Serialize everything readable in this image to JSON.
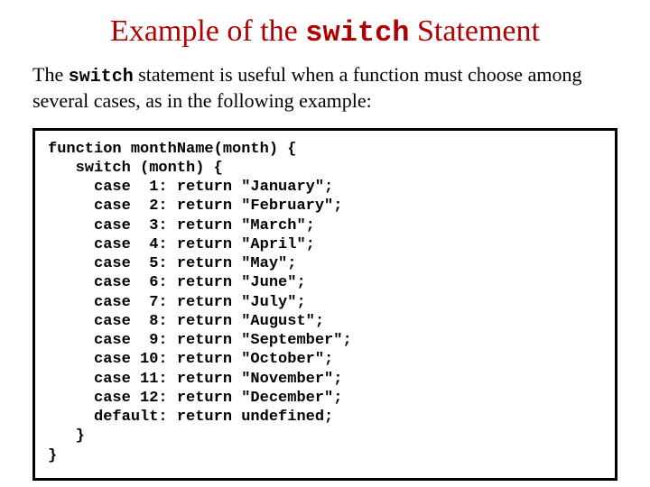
{
  "title_prefix": "Example of the ",
  "title_code": "switch",
  "title_suffix": " Statement",
  "intro_prefix": "The ",
  "intro_code": "switch",
  "intro_suffix": " statement is useful when a function must choose among several cases, as in the following example:",
  "code": "function monthName(month) {\n   switch (month) {\n     case  1: return \"January\";\n     case  2: return \"February\";\n     case  3: return \"March\";\n     case  4: return \"April\";\n     case  5: return \"May\";\n     case  6: return \"June\";\n     case  7: return \"July\";\n     case  8: return \"August\";\n     case  9: return \"September\";\n     case 10: return \"October\";\n     case 11: return \"November\";\n     case 12: return \"December\";\n     default: return undefined;\n   }\n}"
}
